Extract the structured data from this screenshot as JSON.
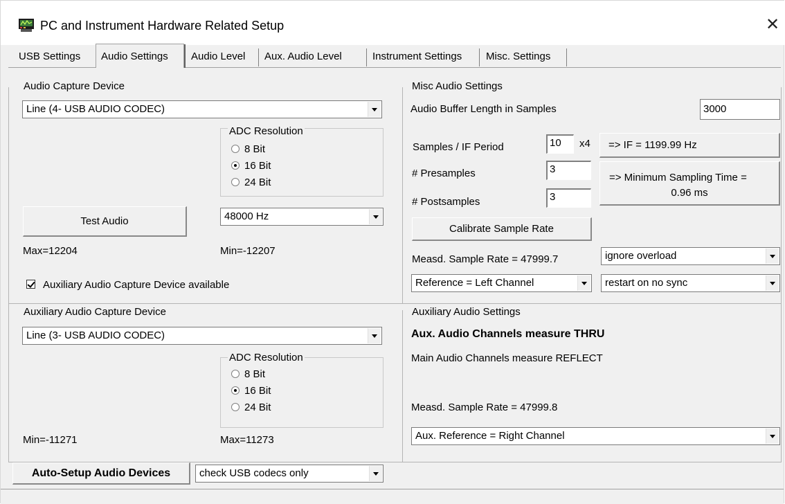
{
  "window": {
    "title": "PC and Instrument Hardware Related Setup",
    "close_glyph": "✕"
  },
  "tabs": [
    {
      "label": "USB Settings"
    },
    {
      "label": "Audio Settings"
    },
    {
      "label": "Audio Level"
    },
    {
      "label": "Aux. Audio Level"
    },
    {
      "label": "Instrument Settings"
    },
    {
      "label": "Misc. Settings"
    }
  ],
  "active_tab": "Audio Settings",
  "capture": {
    "legend": "Audio Capture Device",
    "device": "Line (4- USB AUDIO  CODEC)",
    "adc_legend": "ADC Resolution",
    "adc_options": [
      "8 Bit",
      "16 Bit",
      "24 Bit"
    ],
    "adc_selected": "16 Bit",
    "test_button": "Test Audio",
    "rate": "48000 Hz",
    "max_label": "Max=12204",
    "min_label": "Min=-12207",
    "aux_checkbox_label": "Auxiliary Audio Capture Device available",
    "aux_checked": true
  },
  "aux_capture": {
    "legend": "Auxiliary Audio Capture Device",
    "device": "Line (3- USB AUDIO  CODEC)",
    "adc_legend": "ADC Resolution",
    "adc_options": [
      "8 Bit",
      "16 Bit",
      "24 Bit"
    ],
    "adc_selected": "16 Bit",
    "min_label": "Min=-11271",
    "max_label": "Max=11273"
  },
  "misc": {
    "legend": "Misc Audio Settings",
    "buffer_label": "Audio Buffer Length in Samples",
    "buffer_value": "3000",
    "samples_if_label": "Samples / IF Period",
    "samples_if_value": "10",
    "multiplier": "x4",
    "if_result": "=> IF =   1199.99 Hz",
    "presamples_label": "# Presamples",
    "presamples_value": "3",
    "postsamples_label": "# Postsamples",
    "postsamples_value": "3",
    "min_sampling_line1": "=> Minimum Sampling Time =",
    "min_sampling_line2": "0.96 ms",
    "calibrate_button": "Calibrate Sample Rate",
    "measd_rate": "Measd. Sample Rate = 47999.7",
    "overload_option": "ignore overload",
    "reference_option": "Reference = Left Channel",
    "sync_option": "restart on no sync"
  },
  "aux_settings": {
    "legend": "Auxiliary Audio Settings",
    "heading": "Aux. Audio Channels measure THRU",
    "main_note": "Main Audio Channels measure REFLECT",
    "measd_rate": "Measd. Sample Rate = 47999.8",
    "reference_option": "Aux. Reference = Right Channel"
  },
  "bottom": {
    "auto_setup_button": "Auto-Setup Audio Devices",
    "codec_filter": "check USB codecs only"
  },
  "icons": {
    "app": "instrument-app-icon",
    "close": "close-icon",
    "dropdown": "chevron-down-icon"
  }
}
